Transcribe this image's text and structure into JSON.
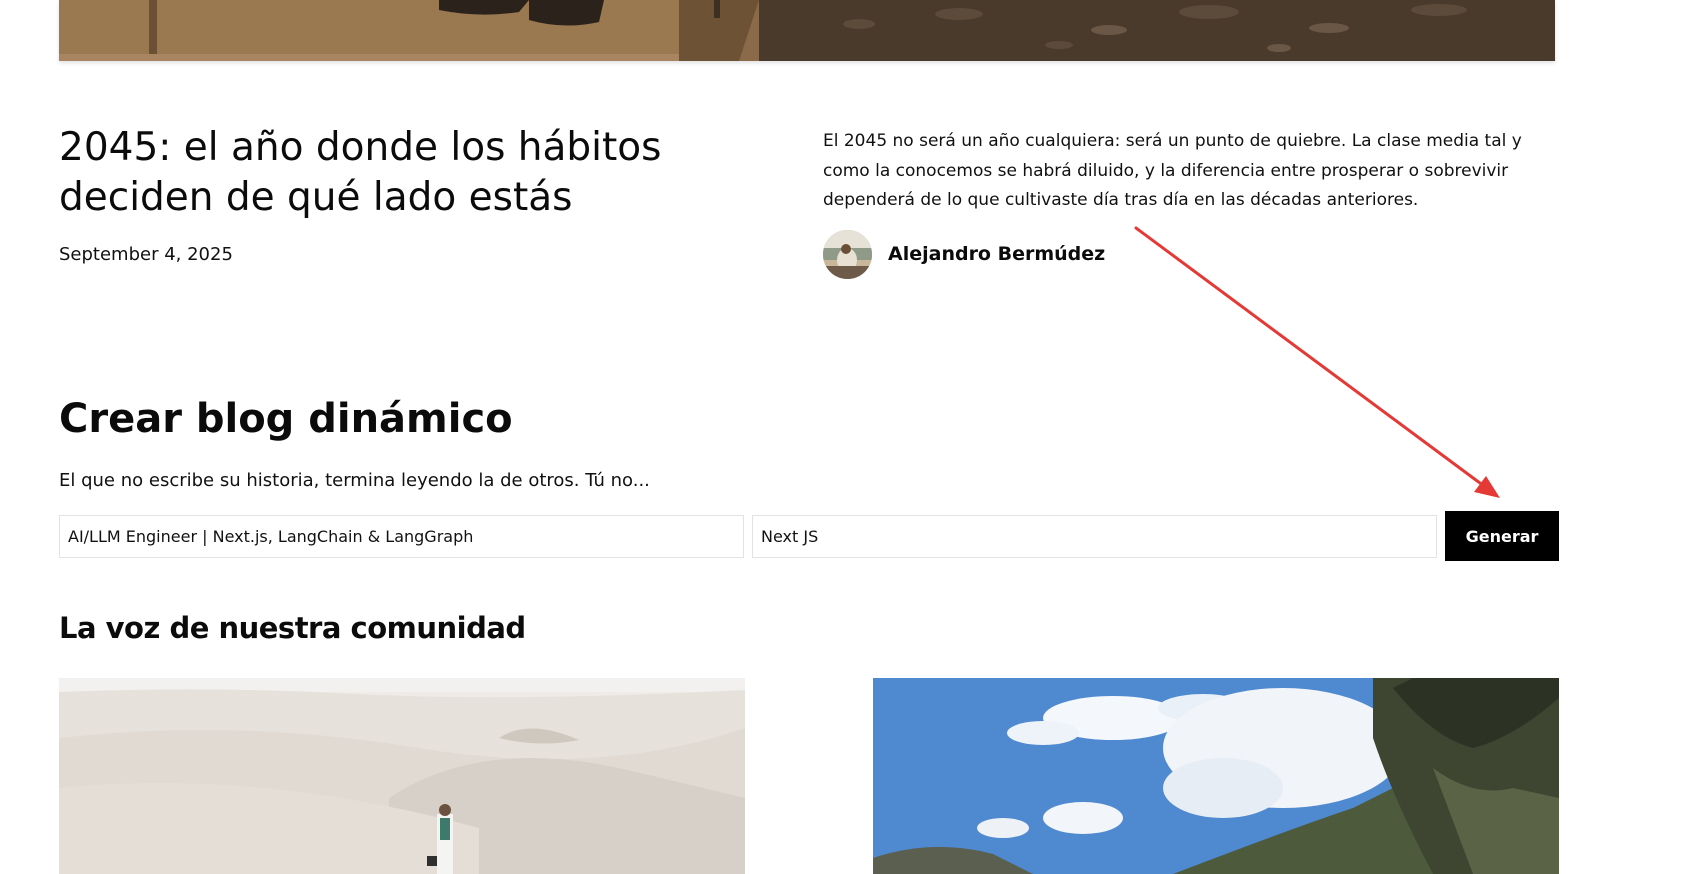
{
  "post": {
    "title": "2045: el año donde los hábitos deciden de qué lado estás",
    "date": "September 4, 2025",
    "excerpt": "El 2045 no será un año cualquiera: será un punto de quiebre. La clase media tal y como la conocemos se habrá diluido, y la diferencia entre prosperar o sobrevivir dependerá de lo que cultivaste día tras día en las décadas anteriores.",
    "author_name": "Alejandro Bermúdez"
  },
  "create_blog": {
    "title": "Crear blog dinámico",
    "subtitle": "El que no escribe su historia, termina leyendo la de otros. Tú no...",
    "role_value": "AI/LLM Engineer | Next.js, LangChain & LangGraph",
    "topic_value": "Next JS",
    "generate_label": "Generar"
  },
  "community": {
    "title": "La voz de nuestra comunidad"
  },
  "colors": {
    "annotation_arrow": "#e53935",
    "button_bg": "#000000"
  }
}
